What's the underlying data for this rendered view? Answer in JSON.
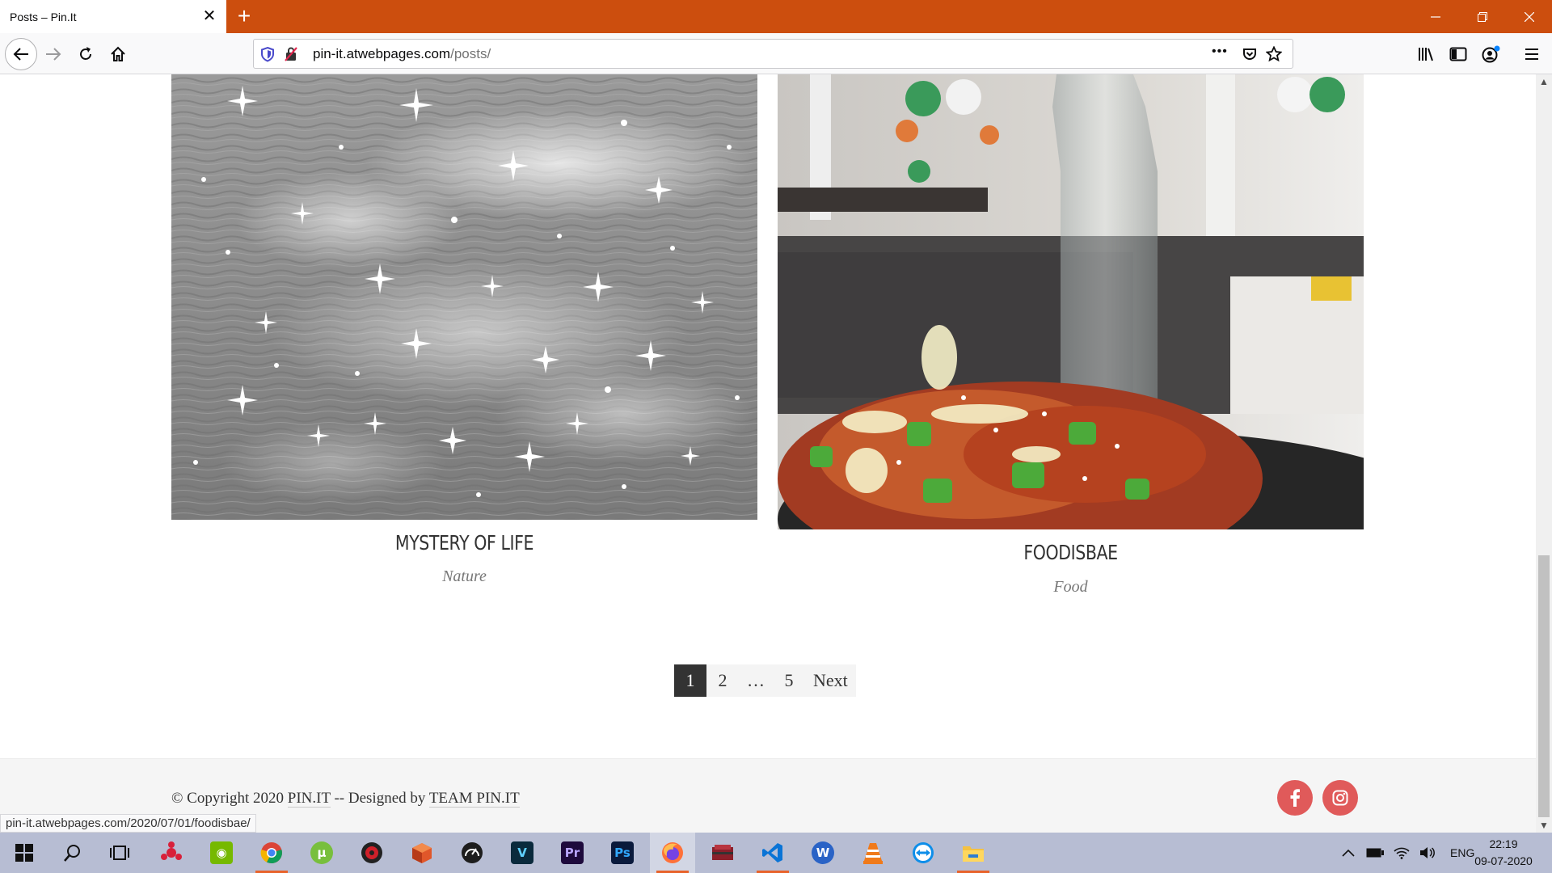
{
  "browser": {
    "tab_title": "Posts – Pin.It",
    "tab_close": "✕",
    "new_tab": "+",
    "url_domain": "pin-it.atwebpages.com",
    "url_path": "/posts/",
    "page_actions": "•••",
    "status_url": "pin-it.atwebpages.com/2020/07/01/foodisbae/"
  },
  "posts": [
    {
      "title": "MYSTERY OF LIFE",
      "category": "Nature"
    },
    {
      "title": "FOODISBAE",
      "category": "Food"
    }
  ],
  "pagination": {
    "pages": [
      "1",
      "2",
      "…",
      "5"
    ],
    "current": "1",
    "next_label": "Next"
  },
  "footer": {
    "copyright_prefix": "© Copyright 2020",
    "brand": "PIN.IT",
    "designed_by": "-- Designed by",
    "team": "TEAM PIN.IT",
    "social": [
      "facebook-icon",
      "instagram-icon"
    ],
    "social_color": "#e05a5a"
  },
  "taskbar": {
    "language": "ENG",
    "time": "22:19",
    "date": "09-07-2020",
    "apps": [
      "windows-start",
      "search",
      "task-view",
      "davinci",
      "nvidia",
      "chrome",
      "utorrent",
      "resolve",
      "box-app",
      "speedometer",
      "vegas",
      "premiere-pro",
      "photoshop",
      "firefox",
      "rar",
      "vscode",
      "word-app",
      "vlc",
      "teamviewer",
      "file-explorer"
    ]
  },
  "colors": {
    "titlebar": "#cc4e0e",
    "pagination_active": "#333333"
  }
}
